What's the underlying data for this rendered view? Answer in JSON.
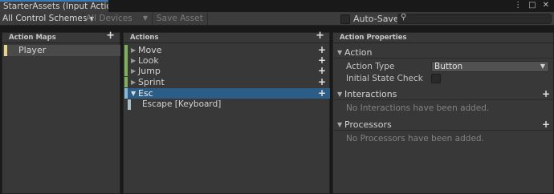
{
  "window": {
    "tab_title": "StarterAssets (Input Actio...",
    "menu_icon": "kebab-icon",
    "maximize_icon": "maximize-icon",
    "close_icon": "close-icon"
  },
  "toolbar": {
    "control_scheme": "All Control Schemes",
    "devices": "All Devices",
    "save_asset": "Save Asset",
    "auto_save": "Auto-Save",
    "search_placeholder": ""
  },
  "action_maps": {
    "title": "Action Maps",
    "items": [
      {
        "label": "Player",
        "color": "#e6d48a"
      }
    ]
  },
  "actions": {
    "title": "Actions",
    "items": [
      {
        "label": "Move",
        "expanded": false
      },
      {
        "label": "Look",
        "expanded": false
      },
      {
        "label": "Jump",
        "expanded": false
      },
      {
        "label": "Sprint",
        "expanded": false
      },
      {
        "label": "Esc",
        "expanded": true,
        "selected": true
      }
    ],
    "bindings": [
      {
        "label": "Escape [Keyboard]"
      }
    ]
  },
  "properties": {
    "title": "Action Properties",
    "action_section": "Action",
    "action_type_label": "Action Type",
    "action_type_value": "Button",
    "initial_state_label": "Initial State Check",
    "interactions_section": "Interactions",
    "interactions_empty": "No Interactions have been added.",
    "processors_section": "Processors",
    "processors_empty": "No Processors have been added."
  },
  "colors": {
    "accent": "#3a79bb",
    "selected_row": "#2c5d87",
    "action_color": "#7fb35a",
    "binding_color": "#a9c2c8"
  }
}
